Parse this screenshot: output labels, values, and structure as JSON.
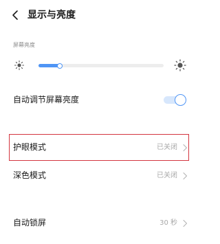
{
  "header": {
    "title": "显示与亮度"
  },
  "brightness": {
    "section_label": "屏幕亮度",
    "level_fraction": 0.17,
    "accent_color": "#4f95f5"
  },
  "auto_brightness": {
    "label": "自动调节屏幕亮度",
    "enabled": true
  },
  "eye_protection": {
    "label": "护眼模式",
    "value": "已关闭"
  },
  "dark_mode": {
    "label": "深色模式",
    "value": "已关闭"
  },
  "auto_lock": {
    "label": "自动锁屏",
    "value": "30 秒"
  },
  "highlight_color": "#d3343f"
}
